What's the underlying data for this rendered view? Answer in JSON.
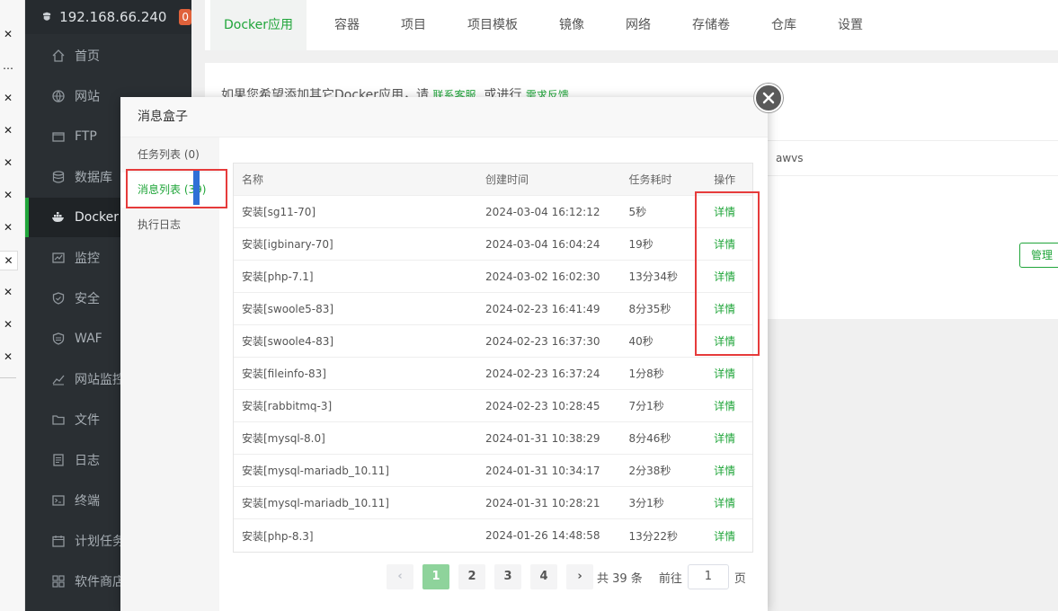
{
  "left_strip": {
    "glyphs": [
      "✕",
      "✕",
      "…",
      "✕",
      "✕",
      "✕",
      "✕",
      "✕",
      "✕",
      "✕",
      "✕",
      "✕"
    ]
  },
  "sidebar": {
    "ip": "192.168.66.240",
    "badge": "0",
    "items": [
      {
        "label": "首页",
        "icon": "home-icon"
      },
      {
        "label": "网站",
        "icon": "globe-icon"
      },
      {
        "label": "FTP",
        "icon": "ftp-icon"
      },
      {
        "label": "数据库",
        "icon": "database-icon"
      },
      {
        "label": "Docker",
        "icon": "docker-icon"
      },
      {
        "label": "监控",
        "icon": "monitor-icon"
      },
      {
        "label": "安全",
        "icon": "shield-icon"
      },
      {
        "label": "WAF",
        "icon": "waf-icon"
      },
      {
        "label": "网站监控",
        "icon": "chart-icon"
      },
      {
        "label": "文件",
        "icon": "folder-icon"
      },
      {
        "label": "日志",
        "icon": "log-icon"
      },
      {
        "label": "终端",
        "icon": "terminal-icon"
      },
      {
        "label": "计划任务",
        "icon": "calendar-icon"
      },
      {
        "label": "软件商店",
        "icon": "apps-icon"
      }
    ]
  },
  "tabs": [
    "Docker应用",
    "容器",
    "项目",
    "项目模板",
    "镜像",
    "网络",
    "存储卷",
    "仓库",
    "设置"
  ],
  "content": {
    "notice_prefix": "如果您希望添加其它Docker应用，请",
    "link_contact": "联系客服",
    "notice_mid": ",或进行",
    "link_feedback": "需求反馈",
    "awvs": "awvs",
    "manage": "管理"
  },
  "modal": {
    "title": "消息盒子",
    "menu": [
      "任务列表 (0)",
      "消息列表 (39)",
      "执行日志"
    ],
    "columns": [
      "名称",
      "创建时间",
      "任务耗时",
      "操作"
    ],
    "rows": [
      {
        "name": "安装[sg11-70]",
        "time": "2024-03-04 16:12:12",
        "duration": "5秒",
        "action": "详情"
      },
      {
        "name": "安装[igbinary-70]",
        "time": "2024-03-04 16:04:24",
        "duration": "19秒",
        "action": "详情"
      },
      {
        "name": "安装[php-7.1]",
        "time": "2024-03-02 16:02:30",
        "duration": "13分34秒",
        "action": "详情"
      },
      {
        "name": "安装[swoole5-83]",
        "time": "2024-02-23 16:41:49",
        "duration": "8分35秒",
        "action": "详情"
      },
      {
        "name": "安装[swoole4-83]",
        "time": "2024-02-23 16:37:30",
        "duration": "40秒",
        "action": "详情"
      },
      {
        "name": "安装[fileinfo-83]",
        "time": "2024-02-23 16:37:24",
        "duration": "1分8秒",
        "action": "详情"
      },
      {
        "name": "安装[rabbitmq-3]",
        "time": "2024-02-23 10:28:45",
        "duration": "7分1秒",
        "action": "详情"
      },
      {
        "name": "安装[mysql-8.0]",
        "time": "2024-01-31 10:38:29",
        "duration": "8分46秒",
        "action": "详情"
      },
      {
        "name": "安装[mysql-mariadb_10.11]",
        "time": "2024-01-31 10:34:17",
        "duration": "2分38秒",
        "action": "详情"
      },
      {
        "name": "安装[mysql-mariadb_10.11]",
        "time": "2024-01-31 10:28:21",
        "duration": "3分1秒",
        "action": "详情"
      },
      {
        "name": "安装[php-8.3]",
        "time": "2024-01-26 14:48:58",
        "duration": "13分22秒",
        "action": "详情"
      }
    ],
    "pagination": {
      "prev": "‹",
      "pages": [
        "1",
        "2",
        "3",
        "4"
      ],
      "next": "›",
      "total": "共 39 条",
      "goto_label": "前往",
      "goto_value": "1",
      "page_unit": "页"
    }
  }
}
